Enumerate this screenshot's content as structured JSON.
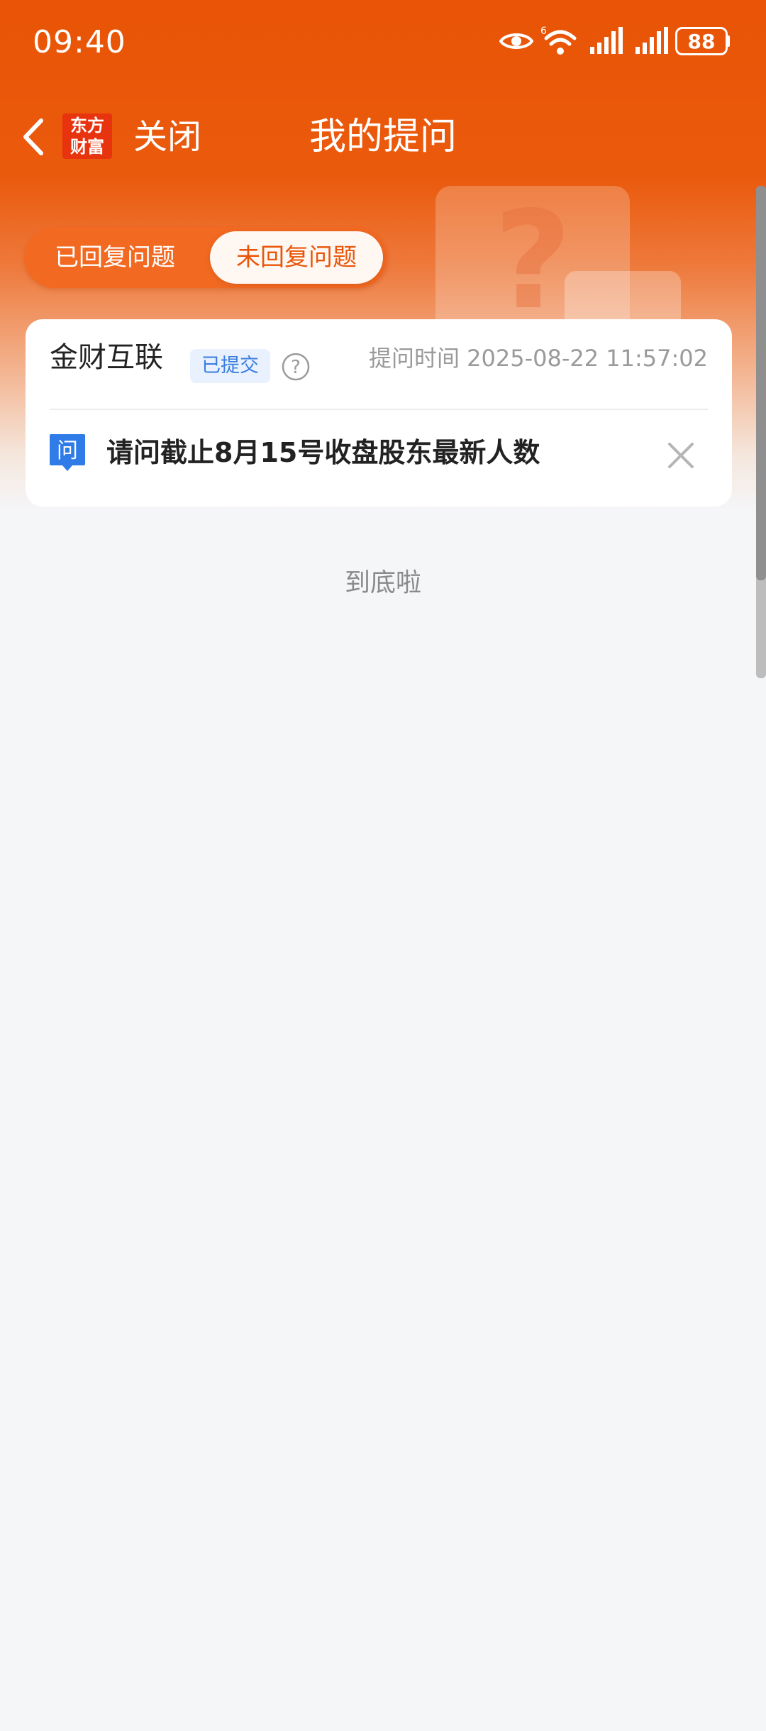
{
  "status_bar": {
    "time": "09:40",
    "battery": "88",
    "wifi_badge": "6",
    "icons": [
      "eye-icon",
      "wifi-icon",
      "signal-icon",
      "signal-icon",
      "battery-icon"
    ]
  },
  "nav": {
    "logo_line1": "东方",
    "logo_line2": "财富",
    "close_label": "关闭",
    "title": "我的提问"
  },
  "tabs": [
    {
      "label": "已回复问题",
      "selected": false
    },
    {
      "label": "未回复问题",
      "selected": true
    }
  ],
  "card": {
    "company": "金财互联",
    "badge": "已提交",
    "ask_time": "提问时间 2025-08-22 11:57:02",
    "question_icon_text": "问",
    "question": "请问截止8月15号收盘股东最新人数"
  },
  "footer": {
    "end_text": "到底啦"
  },
  "colors": {
    "brand": "#e95406",
    "badge_blue": "#3a7de0",
    "tab_selected_text": "#e8560a"
  }
}
